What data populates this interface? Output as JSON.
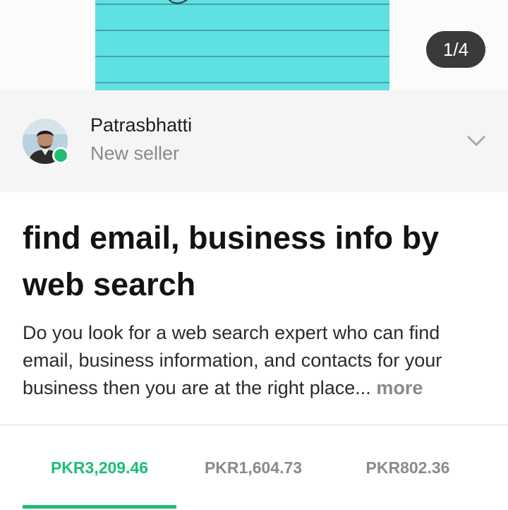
{
  "gallery": {
    "counter": "1/4"
  },
  "seller": {
    "name": "Patrasbhatti",
    "level": "New seller",
    "status_color": "#1dbf73"
  },
  "gig": {
    "title": "find email, business info by web search",
    "description": "Do you look for a web search expert who can find email, business information, and contacts for your business then you are at the right place...",
    "more_label": "more"
  },
  "tabs": [
    {
      "label": "PKR3,209.46",
      "active": true
    },
    {
      "label": "PKR1,604.73",
      "active": false
    },
    {
      "label": "PKR802.36",
      "active": false
    }
  ],
  "colors": {
    "accent": "#1dbf73",
    "gallery_image": "#5fe1e4",
    "counter_bg": "#3a3a3a"
  },
  "icons": {
    "expand": "chevron-down-icon"
  }
}
